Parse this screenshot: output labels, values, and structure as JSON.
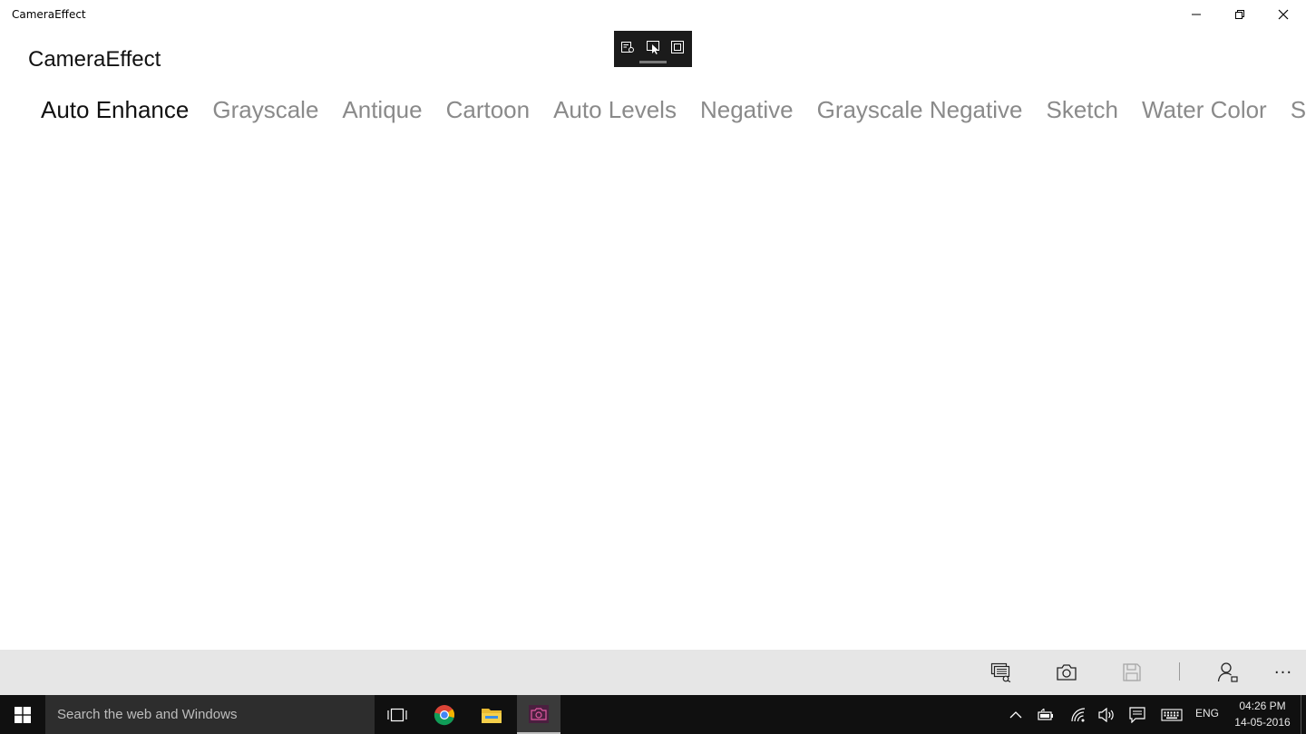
{
  "window": {
    "title": "CameraEffect",
    "controls": [
      "minimize-icon",
      "restore-icon",
      "close-icon"
    ]
  },
  "debug_toolbar": {
    "icons": [
      "visual-tree-icon",
      "select-element-icon",
      "layout-adorner-icon"
    ]
  },
  "app": {
    "title": "CameraEffect",
    "tabs": [
      {
        "label": "Auto Enhance",
        "active": true
      },
      {
        "label": "Grayscale",
        "active": false
      },
      {
        "label": "Antique",
        "active": false
      },
      {
        "label": "Cartoon",
        "active": false
      },
      {
        "label": "Auto Levels",
        "active": false
      },
      {
        "label": "Negative",
        "active": false
      },
      {
        "label": "Grayscale Negative",
        "active": false
      },
      {
        "label": "Sketch",
        "active": false
      },
      {
        "label": "Water Color",
        "active": false
      },
      {
        "label": "Sepia",
        "active": false
      }
    ]
  },
  "command_bar": {
    "buttons": [
      "switch-camera-icon",
      "camera-icon",
      "save-icon",
      "contact-icon"
    ],
    "more": "···"
  },
  "taskbar": {
    "search_placeholder": "Search the web and Windows",
    "apps": [
      "task-view-icon",
      "chrome-icon",
      "file-explorer-icon",
      "camera-effect-app-icon"
    ],
    "language": "ENG",
    "time": "04:26 PM",
    "date": "14-05-2016"
  },
  "colors": {
    "active_tab": "#111111",
    "inactive_tab": "#8a8a8a",
    "command_bar": "#e6e6e6",
    "taskbar": "#101010"
  }
}
